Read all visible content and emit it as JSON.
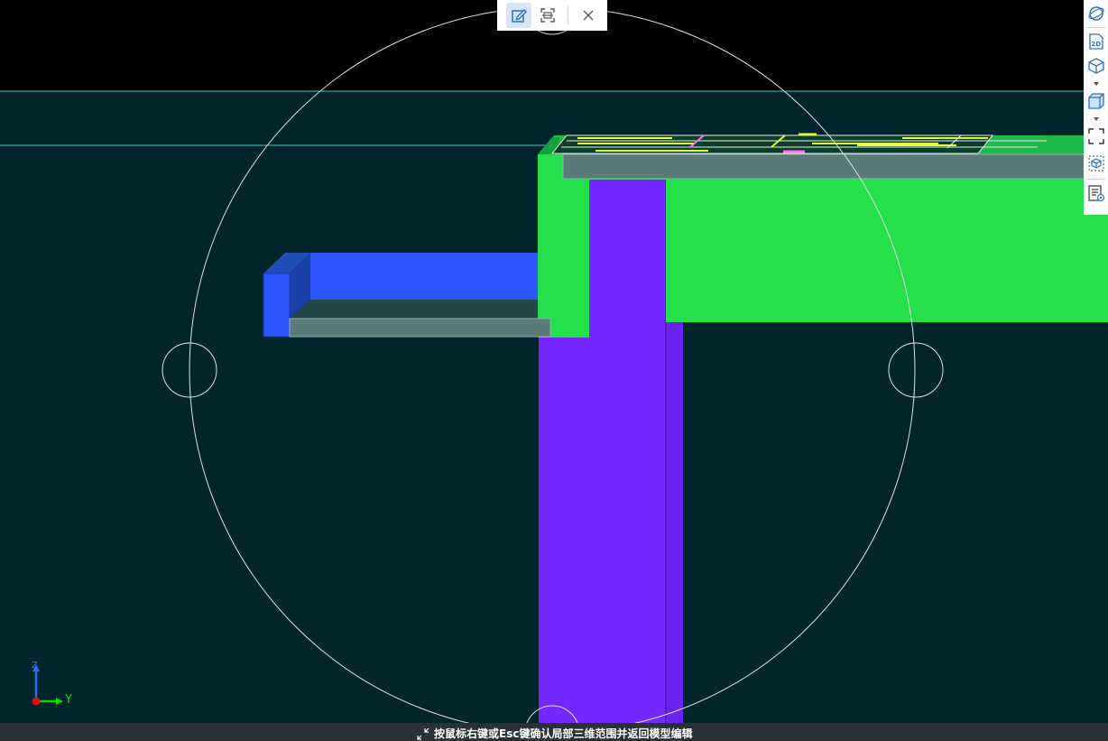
{
  "toolbar": {
    "edit_icon": "edit-icon",
    "scan_icon": "scan-range-icon",
    "close_icon": "close-icon"
  },
  "right_toolbar": {
    "items": [
      {
        "name": "view-orbit-icon"
      },
      {
        "name": "2d-view-icon",
        "label": "2D"
      },
      {
        "name": "3d-view-icon"
      },
      {
        "name": "solid-display-icon"
      },
      {
        "name": "zoom-extents-icon"
      },
      {
        "name": "local-3d-icon"
      },
      {
        "name": "properties-view-icon"
      }
    ]
  },
  "axis": {
    "y_label": "Y",
    "z_label": "Z"
  },
  "status": {
    "message": "按鼠标右键或Esc键确认局部三维范围并返回模型编辑",
    "icon": "collapse-arrows-icon"
  },
  "colors": {
    "background": "#00252b",
    "beam_green": "#25e04b",
    "column_purple": "#7428ff",
    "beam_blue": "#2d55ff",
    "slab_gray": "#5a7a7a",
    "guide_cyan": "#4ec4c4"
  }
}
